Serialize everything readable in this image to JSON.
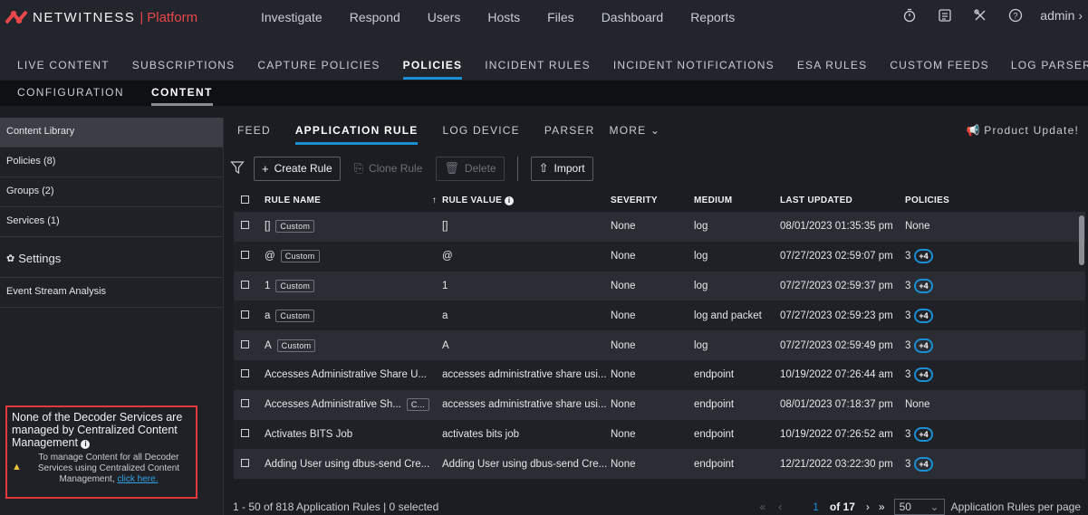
{
  "brand": {
    "name": "NETWITNESS",
    "sep": "|",
    "product": "Platform"
  },
  "main_nav": [
    "Investigate",
    "Respond",
    "Users",
    "Hosts",
    "Files",
    "Dashboard",
    "Reports"
  ],
  "top_icons": [
    "timer-icon",
    "notes-icon",
    "tools-icon",
    "help-icon"
  ],
  "user": "admin",
  "sub_nav": {
    "items": [
      "LIVE CONTENT",
      "SUBSCRIPTIONS",
      "CAPTURE POLICIES",
      "POLICIES",
      "INCIDENT RULES",
      "INCIDENT NOTIFICATIONS",
      "ESA RULES",
      "CUSTOM FEEDS",
      "LOG PARSER"
    ],
    "active": "POLICIES"
  },
  "tert_nav": {
    "items": [
      "CONFIGURATION",
      "CONTENT"
    ],
    "active": "CONTENT"
  },
  "sidebar": {
    "items": [
      "Content Library",
      "Policies (8)",
      "Groups (2)",
      "Services (1)"
    ],
    "active": "Content Library",
    "settings_label": "Settings",
    "esa_label": "Event Stream Analysis",
    "notice": {
      "message": "None of the Decoder Services are managed by Centralized Content Management",
      "sub_prefix": "To manage Content for all Decoder Services using Centralized Content Management, ",
      "link": "click here."
    }
  },
  "tabs": {
    "items": [
      "FEED",
      "APPLICATION RULE",
      "LOG DEVICE",
      "PARSER",
      "MORE"
    ],
    "active": "APPLICATION RULE",
    "product_update": "Product Update!"
  },
  "toolbar": {
    "create": "Create Rule",
    "clone": "Clone Rule",
    "delete": "Delete",
    "import": "Import"
  },
  "table": {
    "columns": [
      "RULE NAME",
      "RULE VALUE",
      "SEVERITY",
      "MEDIUM",
      "LAST UPDATED",
      "POLICIES"
    ],
    "rows": [
      {
        "name": "[]",
        "tag": "Custom",
        "value": "[]",
        "severity": "None",
        "medium": "log",
        "updated": "08/01/2023 01:35:35 pm",
        "policies": "None",
        "extra": ""
      },
      {
        "name": "@",
        "tag": "Custom",
        "value": "@",
        "severity": "None",
        "medium": "log",
        "updated": "07/27/2023 02:59:07 pm",
        "policies": "3",
        "extra": "+4"
      },
      {
        "name": "1",
        "tag": "Custom",
        "value": "1",
        "severity": "None",
        "medium": "log",
        "updated": "07/27/2023 02:59:37 pm",
        "policies": "3",
        "extra": "+4"
      },
      {
        "name": "a",
        "tag": "Custom",
        "value": "a",
        "severity": "None",
        "medium": "log and packet",
        "updated": "07/27/2023 02:59:23 pm",
        "policies": "3",
        "extra": "+4"
      },
      {
        "name": "A",
        "tag": "Custom",
        "value": "A",
        "severity": "None",
        "medium": "log",
        "updated": "07/27/2023 02:59:49 pm",
        "policies": "3",
        "extra": "+4"
      },
      {
        "name": "Accesses Administrative Share U...",
        "tag": "",
        "value": "accesses administrative share usi...",
        "severity": "None",
        "medium": "endpoint",
        "updated": "10/19/2022 07:26:44 am",
        "policies": "3",
        "extra": "+4"
      },
      {
        "name": "Accesses Administrative Sh...",
        "tag": "C...",
        "value": "accesses administrative share usi...",
        "severity": "None",
        "medium": "endpoint",
        "updated": "08/01/2023 07:18:37 pm",
        "policies": "None",
        "extra": ""
      },
      {
        "name": "Activates BITS Job",
        "tag": "",
        "value": "activates bits job",
        "severity": "None",
        "medium": "endpoint",
        "updated": "10/19/2022 07:26:52 am",
        "policies": "3",
        "extra": "+4"
      },
      {
        "name": "Adding User using dbus-send Cre...",
        "tag": "",
        "value": "Adding User using dbus-send Cre...",
        "severity": "None",
        "medium": "endpoint",
        "updated": "12/21/2022 03:22:30 pm",
        "policies": "3",
        "extra": "+4"
      }
    ]
  },
  "footer": {
    "count": "1 - 50 of 818 Application Rules | 0 selected",
    "page": "1",
    "of": "of 17",
    "per_page": "50",
    "per_page_label": "Application Rules per page"
  }
}
